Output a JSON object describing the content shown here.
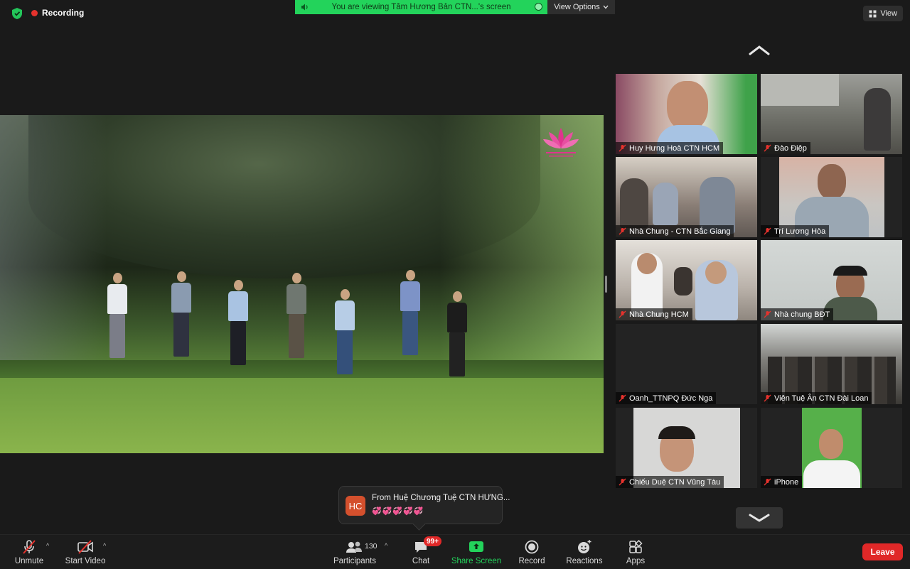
{
  "window": {
    "recording_label": "Recording",
    "share_banner": "You are viewing Tâm Hương Bản CTN...'s screen",
    "view_options_label": "View Options",
    "view_button_label": "View"
  },
  "participants_tiles": [
    {
      "name": "Huy Hưng Hoà CTN HCM"
    },
    {
      "name": "Đào Điệp"
    },
    {
      "name": "Nhà Chung - CTN Bắc Giang"
    },
    {
      "name": "Trí Lương Hòa"
    },
    {
      "name": "Nhà Chung HCM"
    },
    {
      "name": "Nhà chung BĐT"
    },
    {
      "name": "Oanh_TTNPQ Đức Nga"
    },
    {
      "name": "Viên Tuệ Ân CTN Đài Loan"
    },
    {
      "name": "Chiếu Duệ CTN Vũng Tàu"
    },
    {
      "name": "iPhone"
    }
  ],
  "chat_toast": {
    "avatar_initials": "HC",
    "from_text": "From Huệ Chương Tuệ CTN HƯNG...",
    "message": "💞💞💞💞💞"
  },
  "toolbar": {
    "unmute_label": "Unmute",
    "start_video_label": "Start Video",
    "participants_label": "Participants",
    "participants_count": "130",
    "chat_label": "Chat",
    "chat_badge": "99+",
    "share_screen_label": "Share Screen",
    "record_label": "Record",
    "reactions_label": "Reactions",
    "apps_label": "Apps",
    "leave_label": "Leave"
  },
  "colors": {
    "accent_green": "#23d35b",
    "leave_red": "#e02828",
    "muted_red": "#e5322d"
  }
}
